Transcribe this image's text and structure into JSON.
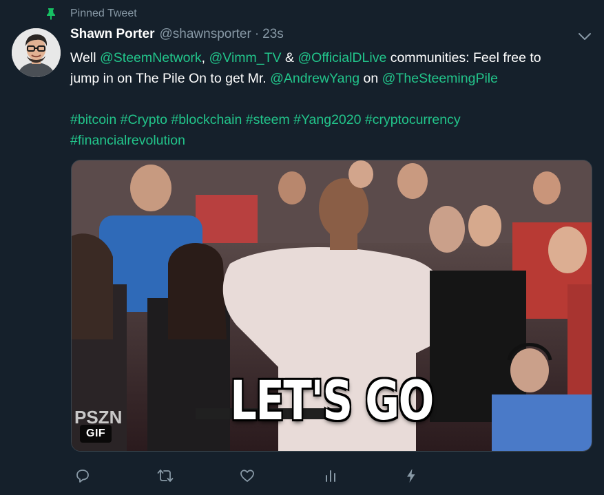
{
  "pinned": {
    "label": "Pinned Tweet",
    "icon": "pin-icon"
  },
  "author": {
    "display_name": "Shawn Porter",
    "handle": "@shawnsporter",
    "separator": "·",
    "timestamp": "23s",
    "avatar_icon": "avatar"
  },
  "tweet": {
    "line1": {
      "w1": "Well ",
      "m1": "@SteemNetwork",
      "t1": ", ",
      "m2": "@Vimm_TV",
      "t2": " & ",
      "m3": "@OfficialDLive",
      "t3": " communities: Feel free to"
    },
    "line2": {
      "t1": "jump in on The Pile On to get Mr. ",
      "m1": "@AndrewYang",
      "t2": " on ",
      "m2": "@TheSteemingPile"
    },
    "hashtags": [
      "#bitcoin",
      "#Crypto",
      "#blockchain",
      "#steem",
      "#Yang2020",
      "#cryptocurrency",
      "#financialrevolution"
    ]
  },
  "media": {
    "badge": "GIF",
    "caption": "LET'S GO",
    "watermark": "PSZN"
  },
  "actions": {
    "reply": "reply-icon",
    "retweet": "retweet-icon",
    "like": "heart-icon",
    "analytics": "analytics-icon",
    "promote": "lightning-icon"
  },
  "colors": {
    "background": "#15202b",
    "secondary_text": "#8899a6",
    "link": "#22c58b",
    "pin": "#17bf63"
  }
}
